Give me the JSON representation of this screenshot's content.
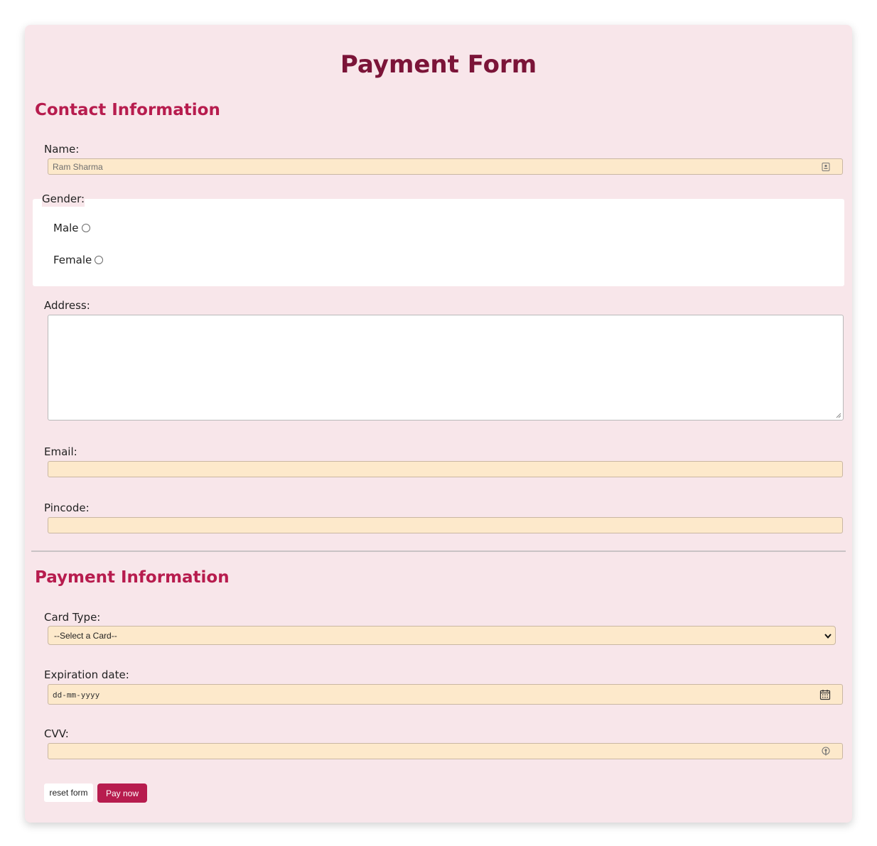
{
  "form": {
    "title": "Payment Form",
    "contact": {
      "heading": "Contact Information",
      "name_label": "Name:",
      "name_value": "Ram Sharma",
      "gender_legend": "Gender:",
      "gender_options": [
        "Male",
        "Female"
      ],
      "address_label": "Address:",
      "address_value": "",
      "email_label": "Email:",
      "email_value": "",
      "pincode_label": "Pincode:",
      "pincode_value": ""
    },
    "payment": {
      "heading": "Payment Information",
      "card_type_label": "Card Type:",
      "card_type_selected": "--Select a Card--",
      "expiration_label": "Expiration date:",
      "expiration_placeholder": "dd-mm-yyyy",
      "cvv_label": "CVV:",
      "cvv_value": ""
    },
    "buttons": {
      "reset_label": "reset form",
      "pay_label": "Pay now"
    }
  },
  "colors": {
    "page_background": "#ffffff",
    "card_background": "#f8e6ea",
    "title_color": "#7b1438",
    "section_heading_color": "#b71c4e",
    "input_background": "#fde9cb",
    "pay_button": "#b71c4e"
  },
  "icons": {
    "name_field": "contact-card-icon",
    "expiration_field": "calendar-icon",
    "cvv_field": "key-icon",
    "card_type": "chevron-down-icon"
  }
}
